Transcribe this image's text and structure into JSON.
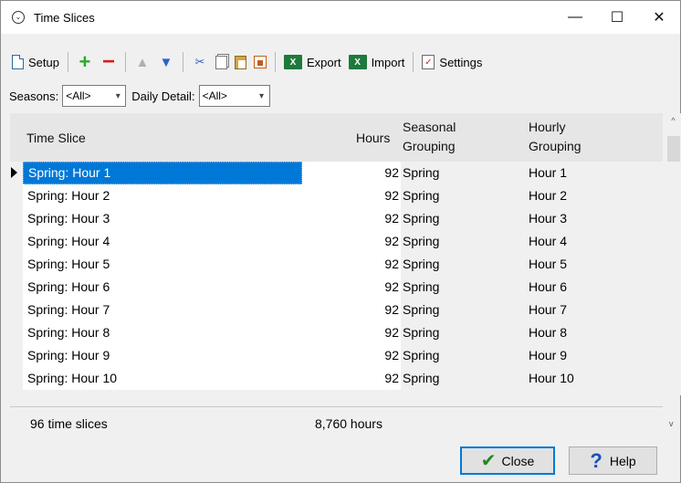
{
  "window": {
    "title": "Time Slices",
    "controls": {
      "minimize": "—",
      "maximize": "☐",
      "close": "✕"
    }
  },
  "toolbar": {
    "setup_label": "Setup",
    "export_label": "Export",
    "import_label": "Import",
    "settings_label": "Settings"
  },
  "filters": {
    "seasons_label": "Seasons:",
    "seasons_value": "<All>",
    "daily_detail_label": "Daily Detail:",
    "daily_detail_value": "<All>"
  },
  "grid": {
    "columns": {
      "time_slice": "Time Slice",
      "hours": "Hours",
      "seasonal_1": "Seasonal",
      "seasonal_2": "Grouping",
      "hourly_1": "Hourly",
      "hourly_2": "Grouping"
    },
    "rows": [
      {
        "name": "Spring: Hour 1",
        "hours": "92",
        "season": "Spring",
        "hourly": "Hour 1"
      },
      {
        "name": "Spring: Hour 2",
        "hours": "92",
        "season": "Spring",
        "hourly": "Hour 2"
      },
      {
        "name": "Spring: Hour 3",
        "hours": "92",
        "season": "Spring",
        "hourly": "Hour 3"
      },
      {
        "name": "Spring: Hour 4",
        "hours": "92",
        "season": "Spring",
        "hourly": "Hour 4"
      },
      {
        "name": "Spring: Hour 5",
        "hours": "92",
        "season": "Spring",
        "hourly": "Hour 5"
      },
      {
        "name": "Spring: Hour 6",
        "hours": "92",
        "season": "Spring",
        "hourly": "Hour 6"
      },
      {
        "name": "Spring: Hour 7",
        "hours": "92",
        "season": "Spring",
        "hourly": "Hour 7"
      },
      {
        "name": "Spring: Hour 8",
        "hours": "92",
        "season": "Spring",
        "hourly": "Hour 8"
      },
      {
        "name": "Spring: Hour 9",
        "hours": "92",
        "season": "Spring",
        "hourly": "Hour 9"
      },
      {
        "name": "Spring: Hour 10",
        "hours": "92",
        "season": "Spring",
        "hourly": "Hour 10"
      }
    ]
  },
  "status": {
    "count": "96 time slices",
    "total_hours": "8,760 hours"
  },
  "buttons": {
    "close_label": "Close",
    "help_label": "Help"
  },
  "colors": {
    "selection": "#0078d7",
    "accent_plus": "#2da82d",
    "accent_minus": "#d91a1a"
  }
}
